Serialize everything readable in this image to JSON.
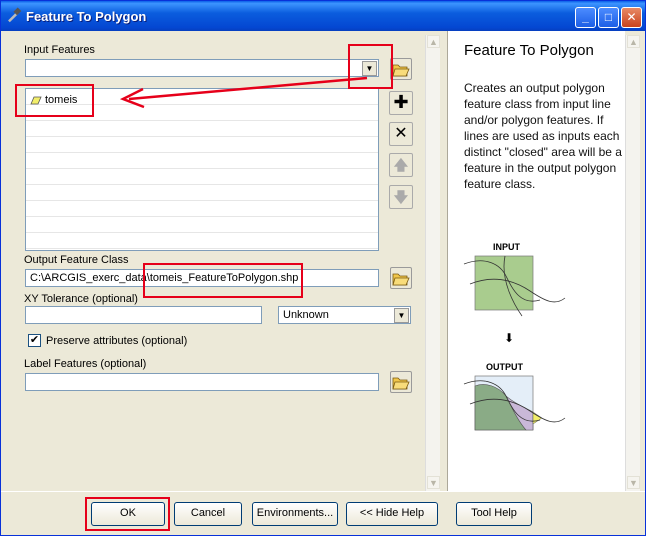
{
  "window": {
    "title": "Feature To Polygon",
    "minimize": "_",
    "maximize": "□",
    "close": "✕"
  },
  "form": {
    "input_features_label": "Input Features",
    "input_features_value": "",
    "list_items": [
      "tomeis"
    ],
    "output_label": "Output Feature Class",
    "output_value": "C:\\ARCGIS_exerc_data\\tomeis_FeatureToPolygon.shp",
    "xy_tolerance_label": "XY Tolerance (optional)",
    "xy_tolerance_value": "",
    "units_value": "Unknown",
    "preserve_label": "Preserve attributes (optional)",
    "preserve_checked": true,
    "label_features_label": "Label Features (optional)",
    "label_features_value": ""
  },
  "help": {
    "title": "Feature To Polygon",
    "body": "Creates an output polygon feature class from input line and/or polygon features. If lines are used as inputs each distinct \"closed\" area will be a feature in the output polygon feature class.",
    "input_caption": "INPUT",
    "output_caption": "OUTPUT"
  },
  "buttons": {
    "ok": "OK",
    "cancel": "Cancel",
    "environments": "Environments...",
    "hide_help": "<< Hide Help",
    "tool_help": "Tool Help"
  },
  "icons": {
    "app": "hammer-icon",
    "browse": "open-folder-icon",
    "add": "plus-icon",
    "remove": "x-icon",
    "up": "arrow-up-icon",
    "down": "arrow-down-icon",
    "feature": "polygon-feature-icon"
  },
  "colors": {
    "titlebar": "#0a5fe8",
    "annotation": "#e6001a",
    "dialog": "#ece9d8"
  }
}
